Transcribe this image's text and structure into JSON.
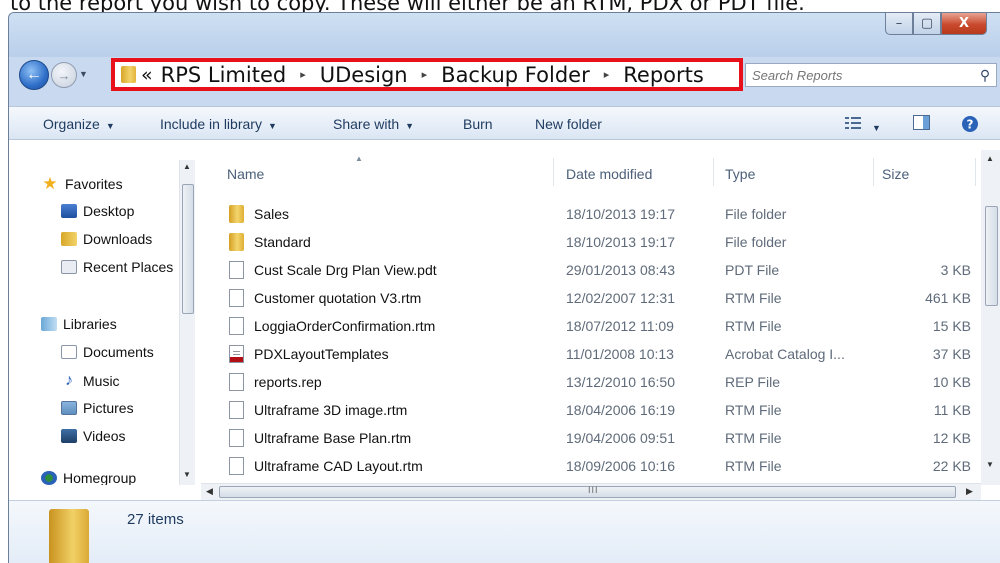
{
  "caption": "to the report you wish to copy. These will either be an RTM, PDX or PDT file.",
  "window": {
    "buttons": {
      "min": "–",
      "max": "▢",
      "close": "X"
    }
  },
  "address": {
    "chevron": "«",
    "crumbs": [
      "RPS Limited",
      "UDesign",
      "Backup Folder",
      "Reports"
    ],
    "separator": "▸"
  },
  "search": {
    "placeholder": "Search Reports"
  },
  "toolbar": {
    "organize": "Organize",
    "include_library": "Include in library",
    "share_with": "Share with",
    "burn": "Burn",
    "new_folder": "New folder"
  },
  "nav": {
    "favorites": "Favorites",
    "desktop": "Desktop",
    "downloads": "Downloads",
    "recent": "Recent Places",
    "libraries": "Libraries",
    "documents": "Documents",
    "music": "Music",
    "pictures": "Pictures",
    "videos": "Videos",
    "homegroup": "Homegroup"
  },
  "columns": {
    "name": "Name",
    "date": "Date modified",
    "type": "Type",
    "size": "Size"
  },
  "files": [
    {
      "name": "Sales",
      "date": "18/10/2013 19:17",
      "type": "File folder",
      "size": "",
      "kind": "folder"
    },
    {
      "name": "Standard",
      "date": "18/10/2013 19:17",
      "type": "File folder",
      "size": "",
      "kind": "folder"
    },
    {
      "name": "Cust Scale Drg Plan View.pdt",
      "date": "29/01/2013 08:43",
      "type": "PDT File",
      "size": "3 KB",
      "kind": "file"
    },
    {
      "name": "Customer quotation V3.rtm",
      "date": "12/02/2007 12:31",
      "type": "RTM File",
      "size": "461 KB",
      "kind": "file"
    },
    {
      "name": "LoggiaOrderConfirmation.rtm",
      "date": "18/07/2012 11:09",
      "type": "RTM File",
      "size": "15 KB",
      "kind": "file"
    },
    {
      "name": "PDXLayoutTemplates",
      "date": "11/01/2008 10:13",
      "type": "Acrobat Catalog I...",
      "size": "37 KB",
      "kind": "pdf"
    },
    {
      "name": "reports.rep",
      "date": "13/12/2010 16:50",
      "type": "REP File",
      "size": "10 KB",
      "kind": "file"
    },
    {
      "name": "Ultraframe 3D image.rtm",
      "date": "18/04/2006 16:19",
      "type": "RTM File",
      "size": "11 KB",
      "kind": "file"
    },
    {
      "name": "Ultraframe Base Plan.rtm",
      "date": "19/04/2006 09:51",
      "type": "RTM File",
      "size": "12 KB",
      "kind": "file"
    },
    {
      "name": "Ultraframe CAD Layout.rtm",
      "date": "18/09/2006 10:16",
      "type": "RTM File",
      "size": "22 KB",
      "kind": "file"
    }
  ],
  "status": {
    "item_count": "27 items"
  }
}
